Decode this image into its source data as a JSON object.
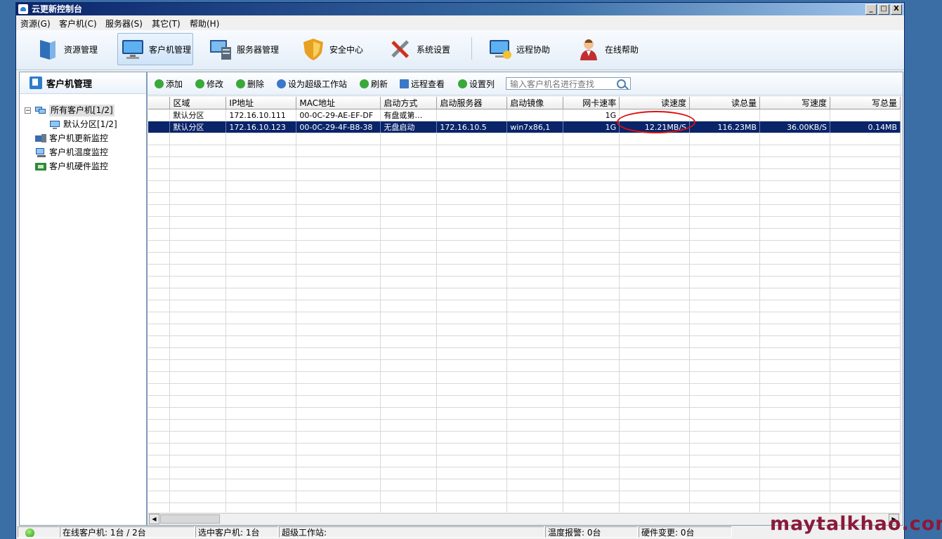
{
  "window": {
    "title": "云更新控制台"
  },
  "window_buttons": [
    "_",
    "□",
    "X"
  ],
  "menu": [
    "资源(G)",
    "客户机(C)",
    "服务器(S)",
    "其它(T)",
    "帮助(H)"
  ],
  "toolbar": [
    {
      "label": "资源管理",
      "icon": "resource-icon"
    },
    {
      "label": "客户机管理",
      "icon": "client-monitor-icon",
      "active": true
    },
    {
      "label": "服务器管理",
      "icon": "server-icon"
    },
    {
      "label": "安全中心",
      "icon": "shield-icon"
    },
    {
      "label": "系统设置",
      "icon": "tools-icon"
    },
    {
      "label": "远程协助",
      "icon": "remote-assist-icon"
    },
    {
      "label": "在线帮助",
      "icon": "help-person-icon"
    }
  ],
  "left_panel": {
    "title": "客户机管理",
    "tree": [
      {
        "label": "所有客户机[1/2]",
        "icon": "computers-icon",
        "selected": true
      },
      {
        "label": "默认分区[1/2]",
        "icon": "computer-icon"
      },
      {
        "label": "客户机更新监控",
        "icon": "update-monitor-icon"
      },
      {
        "label": "客户机温度监控",
        "icon": "temperature-monitor-icon"
      },
      {
        "label": "客户机硬件监控",
        "icon": "hardware-monitor-icon"
      }
    ]
  },
  "actions": [
    {
      "label": "添加",
      "icon": "add-icon",
      "color": "#3aa83a"
    },
    {
      "label": "修改",
      "icon": "edit-icon",
      "color": "#3aa83a"
    },
    {
      "label": "删除",
      "icon": "delete-icon",
      "color": "#3aa83a"
    },
    {
      "label": "设为超级工作站",
      "icon": "user-icon",
      "color": "#3a78c8"
    },
    {
      "label": "刷新",
      "icon": "refresh-icon",
      "color": "#3aa83a"
    },
    {
      "label": "远程查看",
      "icon": "monitor-icon",
      "color": "#3a78c8"
    },
    {
      "label": "设置列",
      "icon": "columns-icon",
      "color": "#3aa83a"
    }
  ],
  "search": {
    "placeholder": "输入客户机名进行查找"
  },
  "table": {
    "columns": [
      "",
      "区域",
      "IP地址",
      "MAC地址",
      "启动方式",
      "启动服务器",
      "启动镜像",
      "网卡速率",
      "读速度",
      "读总量",
      "写速度",
      "写总量"
    ],
    "rows": [
      [
        "",
        "默认分区",
        "172.16.10.111",
        "00-0C-29-AE-EF-DF",
        "有盘或第…",
        "",
        "",
        "1G",
        "",
        "",
        "",
        ""
      ],
      [
        "",
        "默认分区",
        "172.16.10.123",
        "00-0C-29-4F-B8-38",
        "无盘启动",
        "172.16.10.5",
        "win7x86,1",
        "1G",
        "12.21MB/S",
        "116.23MB",
        "36.00KB/S",
        "0.14MB"
      ]
    ],
    "selected_row": 1
  },
  "statusbar": {
    "online": "在线客户机: 1台 / 2台",
    "selected": "选中客户机: 1台",
    "super": "超级工作站:",
    "temp_alarm": "温度报警: 0台",
    "hw_change": "硬件变更: 0台"
  },
  "watermark": "maytalkhao.com",
  "colors": {
    "selection": "#0a246a",
    "annotation": "#e01010",
    "desktop": "#3c6ea6"
  }
}
